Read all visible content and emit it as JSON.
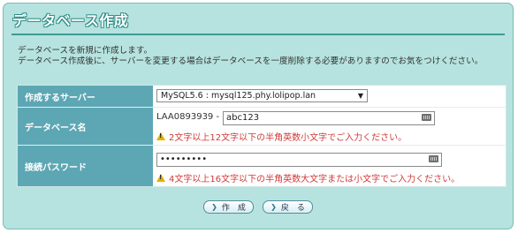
{
  "panel": {
    "title": "データベース作成",
    "description_line1": "データベースを新規に作成します。",
    "description_line2": "データベース作成後に、サーバーを変更する場合はデータベースを一度削除する必要がありますのでお気をつけください。"
  },
  "form": {
    "server": {
      "label": "作成するサーバー",
      "selected": "MySQL5.6 : mysql125.phy.lolipop.lan"
    },
    "dbname": {
      "label": "データベース名",
      "prefix": "LAA0893939 -",
      "value": "abc123",
      "hint": "2文字以上12文字以下の半角英数小文字でご入力ください。"
    },
    "password": {
      "label": "接続パスワード",
      "value": "•••••••••",
      "hint": "4文字以上16文字以下の半角英数大文字または小文字でご入力ください。"
    }
  },
  "buttons": {
    "create": "作　成",
    "back": "戻　る"
  },
  "colors": {
    "panel_bg": "#b6e3df",
    "label_bg": "#5da7b4",
    "warning_text": "#d03a3a"
  }
}
